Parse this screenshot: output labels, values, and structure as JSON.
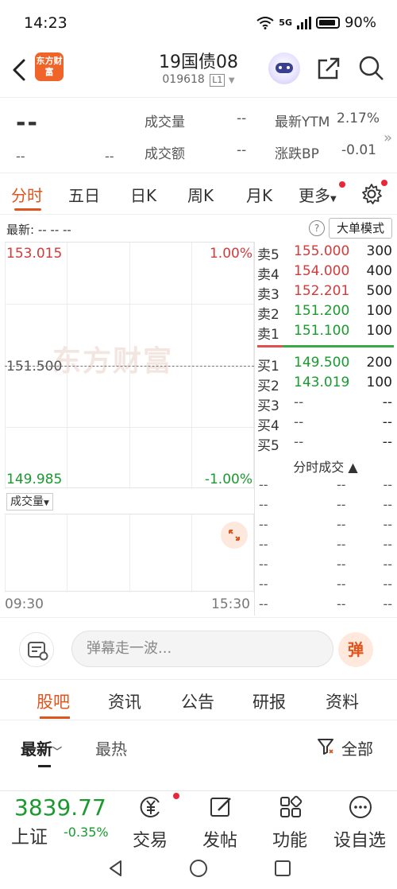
{
  "status": {
    "time": "14:23",
    "network": "5G",
    "battery": "90%"
  },
  "header": {
    "logo_text": "东方财富",
    "stock_name": "19国债08",
    "stock_code": "019618",
    "code_badge": "L1"
  },
  "quote": {
    "price": "--",
    "change": "--",
    "change_pct": "--",
    "volume_label": "成交量",
    "volume_value": "--",
    "amount_label": "成交额",
    "amount_value": "--",
    "ytm_label": "最新YTM",
    "ytm_value": "2.17%",
    "bp_label": "涨跌BP",
    "bp_value": "-0.01"
  },
  "tabs": [
    {
      "label": "分时"
    },
    {
      "label": "五日"
    },
    {
      "label": "日K"
    },
    {
      "label": "周K"
    },
    {
      "label": "月K"
    },
    {
      "label": "更多"
    }
  ],
  "info_row": {
    "latest_label": "最新: -- -- --",
    "big_order_mode": "大单模式"
  },
  "chart": {
    "upper_price": "153.015",
    "upper_pct": "1.00%",
    "mid_price": "151.500",
    "lower_price": "149.985",
    "lower_pct": "-1.00%",
    "watermark": "东方财富",
    "volume_selector": "成交量",
    "time_start": "09:30",
    "time_end": "15:30"
  },
  "order_book": {
    "asks": [
      {
        "label": "卖5",
        "price": "155.000",
        "volume": "300",
        "color": "#d53a3a"
      },
      {
        "label": "卖4",
        "price": "154.000",
        "volume": "400",
        "color": "#d53a3a"
      },
      {
        "label": "卖3",
        "price": "152.201",
        "volume": "500",
        "color": "#d53a3a"
      },
      {
        "label": "卖2",
        "price": "151.200",
        "volume": "100",
        "color": "#1a9a2e"
      },
      {
        "label": "卖1",
        "price": "151.100",
        "volume": "100",
        "color": "#1a9a2e"
      }
    ],
    "bids": [
      {
        "label": "买1",
        "price": "149.500",
        "volume": "200",
        "color": "#1a9a2e"
      },
      {
        "label": "买2",
        "price": "143.019",
        "volume": "100",
        "color": "#1a9a2e"
      },
      {
        "label": "买3",
        "price": "--",
        "volume": "--",
        "color": "#555555"
      },
      {
        "label": "买4",
        "price": "--",
        "volume": "--",
        "color": "#555555"
      },
      {
        "label": "买5",
        "price": "--",
        "volume": "--",
        "color": "#555555"
      }
    ],
    "ticks_header": "分时成交 ▲",
    "ticks": [
      {
        "time": "--",
        "price": "--",
        "volume": "--"
      },
      {
        "time": "--",
        "price": "--",
        "volume": "--"
      },
      {
        "time": "--",
        "price": "--",
        "volume": "--"
      },
      {
        "time": "--",
        "price": "--",
        "volume": "--"
      },
      {
        "time": "--",
        "price": "--",
        "volume": "--"
      },
      {
        "time": "--",
        "price": "--",
        "volume": "--"
      },
      {
        "time": "--",
        "price": "--",
        "volume": "--"
      }
    ]
  },
  "danmu": {
    "placeholder": "弹幕走一波...",
    "button": "弹"
  },
  "guba_tabs": [
    {
      "label": "股吧"
    },
    {
      "label": "资讯"
    },
    {
      "label": "公告"
    },
    {
      "label": "研报"
    },
    {
      "label": "资料"
    }
  ],
  "sort": {
    "latest": "最新",
    "hottest": "最热",
    "filter": "全部"
  },
  "bottom_bar": {
    "index_value": "3839.77",
    "index_name": "上证",
    "index_change": "-0.35%",
    "items": [
      {
        "label": "交易",
        "icon": "yuan-icon"
      },
      {
        "label": "发帖",
        "icon": "edit-icon"
      },
      {
        "label": "功能",
        "icon": "apps-icon"
      },
      {
        "label": "设自选",
        "icon": "more-icon"
      }
    ]
  }
}
